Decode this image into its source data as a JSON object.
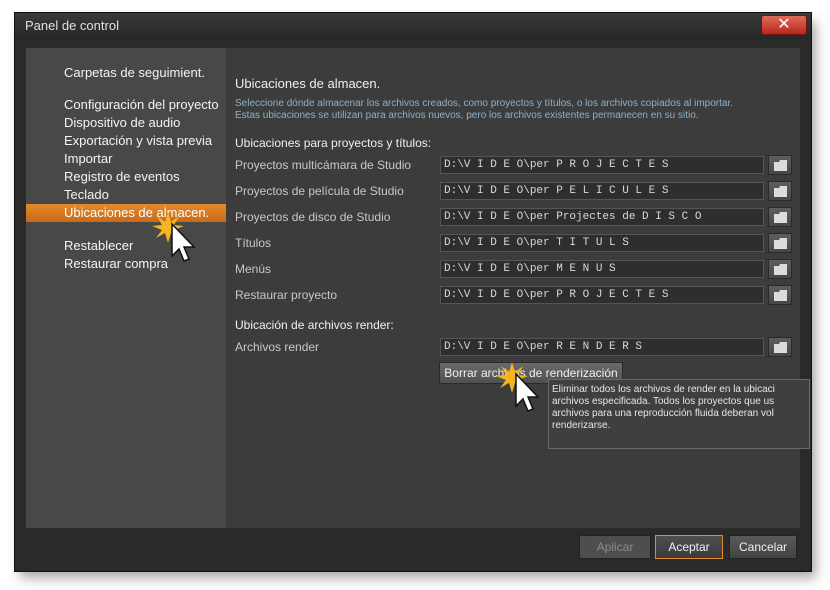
{
  "window": {
    "title": "Panel de control",
    "close_label": "✕"
  },
  "sidebar": {
    "items": [
      {
        "label": "Carpetas de seguimient."
      },
      {
        "label": "Configuración del proyecto"
      },
      {
        "label": "Dispositivo de audio"
      },
      {
        "label": "Exportación y vista previa"
      },
      {
        "label": "Importar"
      },
      {
        "label": "Registro de eventos"
      },
      {
        "label": "Teclado"
      },
      {
        "label": "Ubicaciones de almacen.",
        "selected": true
      },
      {
        "label": "Restablecer"
      },
      {
        "label": "Restaurar compra"
      }
    ]
  },
  "content": {
    "title": "Ubicaciones de almacen.",
    "description_line1": "Seleccione dónde almacenar los archivos creados, como proyectos y títulos, o los archivos copiados al importar.",
    "description_line2": "Estas ubicaciones se utilizan para archivos nuevos, pero los archivos existentes permanecen en su sitio.",
    "projects_section": "Ubicaciones para proyectos y títulos:",
    "rows": [
      {
        "label": "Proyectos multicámara de Studio",
        "path": "D:\\V I D E O\\per  P R O J E C T E S"
      },
      {
        "label": "Proyectos de película de Studio",
        "path": "D:\\V I D E O\\per  P E L I C U L E S"
      },
      {
        "label": "Proyectos de disco de Studio",
        "path": "D:\\V I D E O\\per  Projectes de  D I S C O"
      },
      {
        "label": "Títulos",
        "path": "D:\\V I D E O\\per  T I T U L S"
      },
      {
        "label": "Menús",
        "path": "D:\\V I D E O\\per  M E N U S"
      },
      {
        "label": "Restaurar proyecto",
        "path": "D:\\V I D E O\\per  P R O J E C T E S"
      }
    ],
    "render_section": "Ubicación de archivos render:",
    "render_row": {
      "label": "Archivos render",
      "path": "D:\\V I D E O\\per  R E N D E R S"
    },
    "clear_button": "Borrar archivos de renderización",
    "tooltip_lines": [
      "Eliminar todos los archivos de render en la ubicaci",
      "archivos especificada. Todos los proyectos que us",
      "archivos para una reproducción fluida deberan vol",
      "renderizarse."
    ]
  },
  "footer": {
    "apply": "Aplicar",
    "accept": "Aceptar",
    "cancel": "Cancelar"
  },
  "colors": {
    "accent": "#e38a2d",
    "description": "#8fb0c8",
    "close": "#c9382a"
  }
}
